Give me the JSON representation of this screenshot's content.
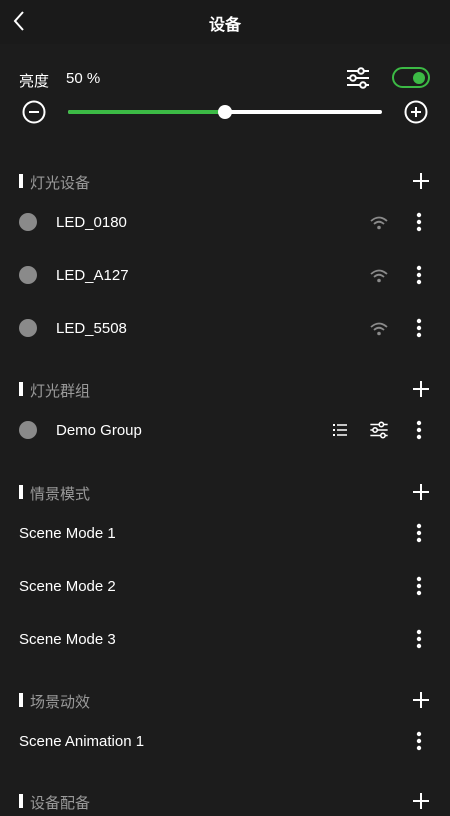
{
  "header": {
    "title": "设备"
  },
  "brightness": {
    "label": "亮度",
    "value_text": "50 %",
    "value": 50,
    "enabled": true
  },
  "colors": {
    "accent": "#3cba45",
    "background": "#1c1c1c",
    "dot": "#8a8a8a",
    "section_title": "#9a9a9a"
  },
  "sections": {
    "light_devices": {
      "title": "灯光设备",
      "items": [
        {
          "name": "LED_0180"
        },
        {
          "name": "LED_A127"
        },
        {
          "name": "LED_5508"
        }
      ]
    },
    "light_groups": {
      "title": "灯光群组",
      "items": [
        {
          "name": "Demo Group"
        }
      ]
    },
    "scene_modes": {
      "title": "情景模式",
      "items": [
        {
          "name": "Scene Mode 1"
        },
        {
          "name": "Scene Mode 2"
        },
        {
          "name": "Scene Mode 3"
        }
      ]
    },
    "scene_animations": {
      "title": "场景动效",
      "items": [
        {
          "name": "Scene Animation 1"
        }
      ]
    },
    "device_config": {
      "title": "设备配备"
    }
  },
  "icons": {
    "back": "chevron-left-icon",
    "adjust": "sliders-icon",
    "minus": "minus-circle-icon",
    "plus": "plus-circle-icon",
    "add": "plus-icon",
    "wifi": "wifi-icon",
    "list": "list-icon",
    "more": "more-vertical-icon"
  }
}
